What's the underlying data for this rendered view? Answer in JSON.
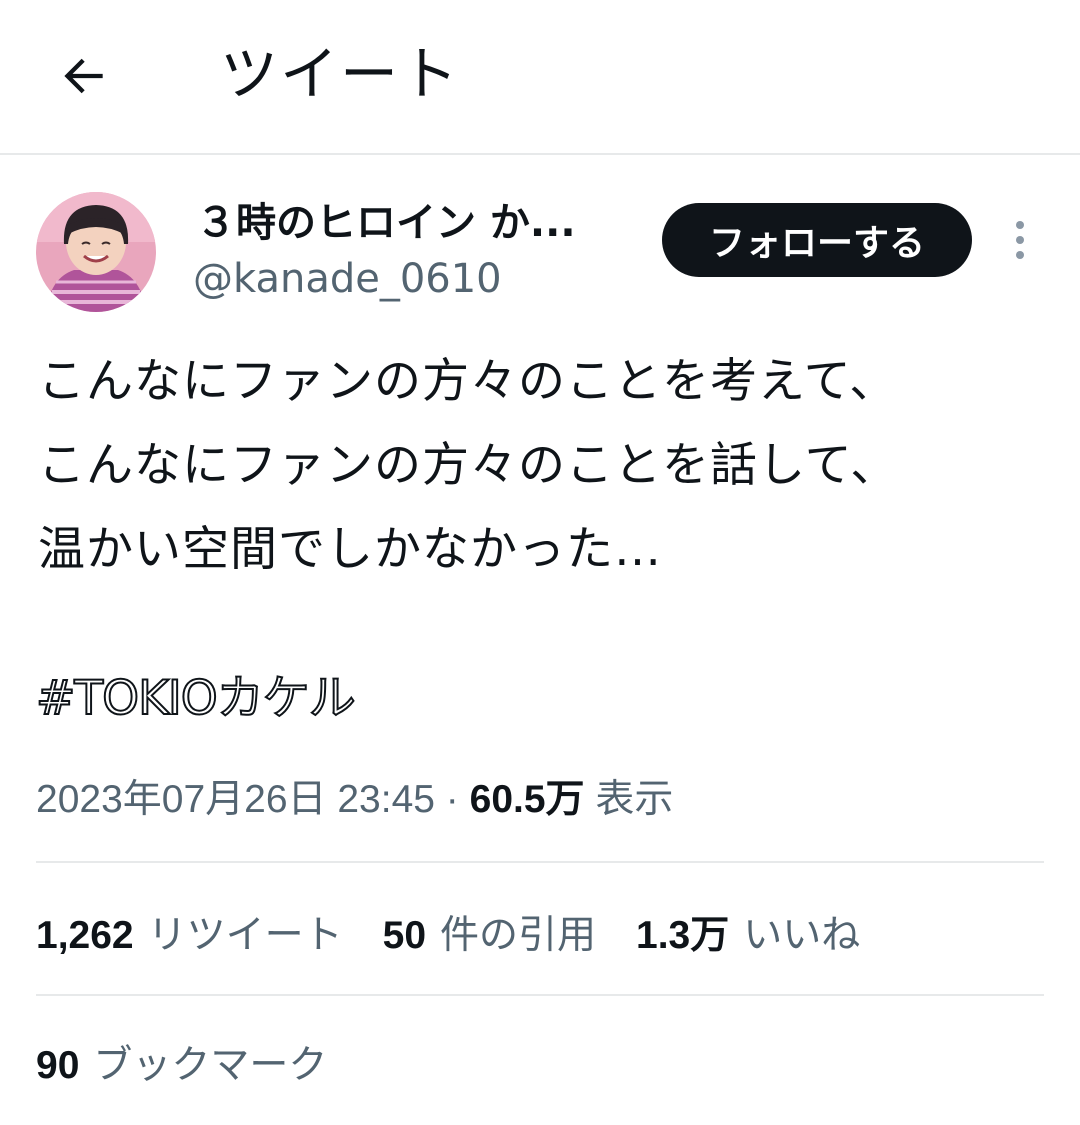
{
  "header": {
    "title": "ツイート"
  },
  "author": {
    "display_name": "３時のヒロイン か...",
    "handle": "@kanade_0610",
    "follow_label": "フォローする"
  },
  "tweet": {
    "lines": [
      "こんなにファンの方々のことを考えて、",
      "こんなにファンの方々のことを話して、",
      "温かい空間でしかなかった…"
    ],
    "hashtag": "#TOKIOカケル",
    "timestamp": "2023年07月26日 23:45",
    "separator": "·",
    "views_count": "60.5万",
    "views_label": "表示"
  },
  "stats": {
    "retweets": {
      "count": "1,262",
      "label": "リツイート"
    },
    "quotes": {
      "count": "50",
      "label": "件の引用"
    },
    "likes": {
      "count": "1.3万",
      "label": "いいね"
    },
    "bookmarks": {
      "count": "90",
      "label": "ブックマーク"
    }
  },
  "colors": {
    "text_primary": "#0f1419",
    "text_secondary": "#536471",
    "divider": "#e7e9ea",
    "follow_button_bg": "#0f1419",
    "avatar_bg": "#e9a0b8"
  },
  "icons": {
    "back": "arrow-left-icon",
    "more": "more-vertical-icon"
  }
}
